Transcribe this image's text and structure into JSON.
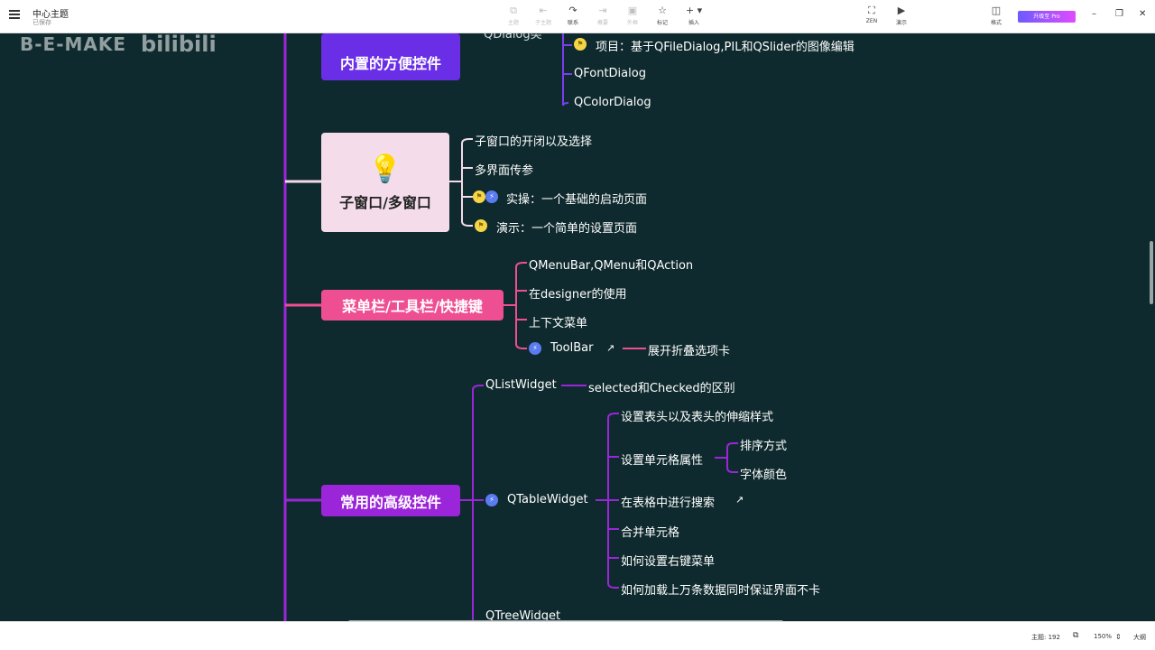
{
  "topbar": {
    "title": "中心主题",
    "status": "已保存",
    "tools": [
      {
        "icon": "⧉",
        "label": "主题",
        "dim": true
      },
      {
        "icon": "⇤",
        "label": "子主题",
        "dim": true
      },
      {
        "icon": "↷",
        "label": "联系",
        "dim": false
      },
      {
        "icon": "⇥",
        "label": "概要",
        "dim": true
      },
      {
        "icon": "▣",
        "label": "外框",
        "dim": true
      },
      {
        "icon": "☆",
        "label": "标记",
        "dim": false
      },
      {
        "icon": "+ ▾",
        "label": "插入",
        "dim": false
      }
    ],
    "right_tools": [
      {
        "icon": "⛶",
        "label": "ZEN"
      },
      {
        "icon": "▶",
        "label": "演示"
      },
      {
        "icon": "◫",
        "label": "格式"
      }
    ],
    "pro_button": "升级至 Pro",
    "window_controls": [
      "–",
      "❐",
      "✕"
    ]
  },
  "watermark": {
    "text": "B-E-MAKE",
    "logo": "bilibili"
  },
  "mindmap": {
    "builtin": {
      "title": "内置的方便控件",
      "clipped": "QDialog类",
      "children": [
        "项目：基于QFileDialog,PIL和QSlider的图像编辑",
        "QFontDialog",
        "QColorDialog"
      ]
    },
    "subwindow": {
      "title": "子窗口/多窗口",
      "children": [
        "子窗口的开闭以及选择",
        "多界面传参",
        "实操：一个基础的启动页面",
        "演示：一个简单的设置页面"
      ]
    },
    "menubar": {
      "title": "菜单栏/工具栏/快捷键",
      "children": [
        "QMenuBar,QMenu和QAction",
        "在designer的使用",
        "上下文菜单",
        "ToolBar"
      ],
      "toolbar_child": "展开折叠选项卡"
    },
    "advanced": {
      "title": "常用的高级控件",
      "qlist": "QListWidget",
      "qlist_child": "selected和Checked的区别",
      "qtable": "QTableWidget",
      "qtable_children": [
        "设置表头以及表头的伸缩样式",
        "设置单元格属性",
        "在表格中进行搜索",
        "合并单元格",
        "如何设置右键菜单",
        "如何加载上万条数据同时保证界面不卡"
      ],
      "cell_children": [
        "排序方式",
        "字体颜色"
      ],
      "qtree": "QTreeWidget"
    }
  },
  "bottombar": {
    "topic_count": "主题: 192",
    "zoom": "150%",
    "outline": "大纲"
  }
}
